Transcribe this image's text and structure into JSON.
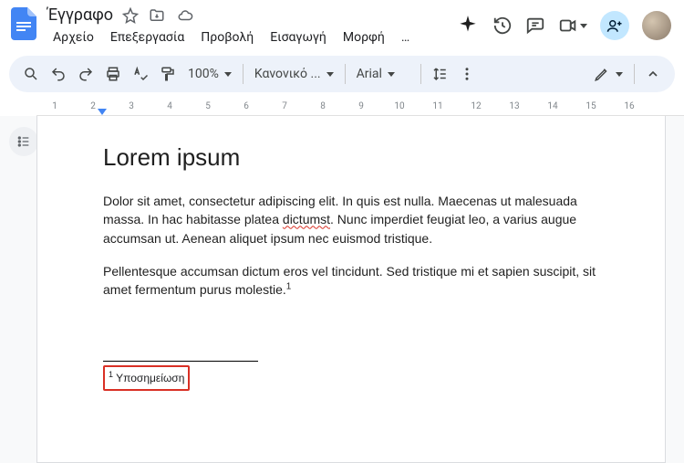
{
  "header": {
    "title": "Έγγραφο",
    "menu": [
      "Αρχείο",
      "Επεξεργασία",
      "Προβολή",
      "Εισαγωγή",
      "Μορφή",
      "…"
    ]
  },
  "toolbar": {
    "zoom": "100%",
    "style": "Κανονικό ...",
    "font": "Arial"
  },
  "ruler": {
    "ticks": [
      1,
      2,
      3,
      4,
      5,
      6,
      7,
      8,
      9,
      10,
      11,
      12,
      13,
      14,
      15,
      16
    ]
  },
  "document": {
    "heading": "Lorem ipsum",
    "p1_a": "Dolor sit amet, consectetur adipiscing elit. In quis est nulla. Maecenas ut malesuada massa. In hac habitasse platea ",
    "p1_err": "dictumst",
    "p1_b": ". Nunc imperdiet feugiat leo, a varius augue accumsan ut. Aenean aliquet ipsum nec euismod tristique.",
    "p2": "Pellentesque accumsan dictum eros vel tincidunt. Sed tristique mi et sapien suscipit, sit amet fermentum purus molestie.",
    "footnote_marker": "1",
    "footnote_text": "Υποσημείωση"
  }
}
